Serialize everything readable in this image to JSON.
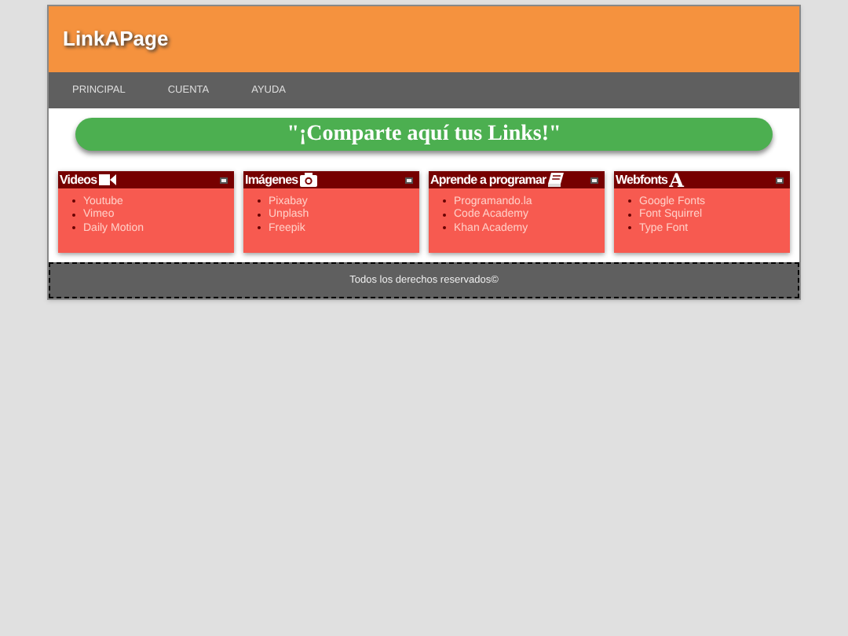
{
  "header": {
    "logo": "LinkAPage"
  },
  "nav": {
    "items": [
      "PRINCIPAL",
      "CUENTA",
      "AYUDA"
    ]
  },
  "banner": {
    "text": "\"¡Comparte aquí tus Links!\""
  },
  "cards": [
    {
      "title": "Videos",
      "links": [
        "Youtube",
        "Vimeo",
        "Daily Motion"
      ]
    },
    {
      "title": "Imágenes",
      "links": [
        "Pixabay",
        "Unplash",
        "Freepik"
      ]
    },
    {
      "title": "Aprende a programar",
      "links": [
        "Programando.la",
        "Code Academy",
        "Khan Academy"
      ]
    },
    {
      "title": "Webfonts",
      "glyph": "A",
      "links": [
        "Google Fonts",
        "Font Squirrel",
        "Type Font"
      ]
    }
  ],
  "footer": {
    "text": "Todos los derechos reservados©"
  }
}
